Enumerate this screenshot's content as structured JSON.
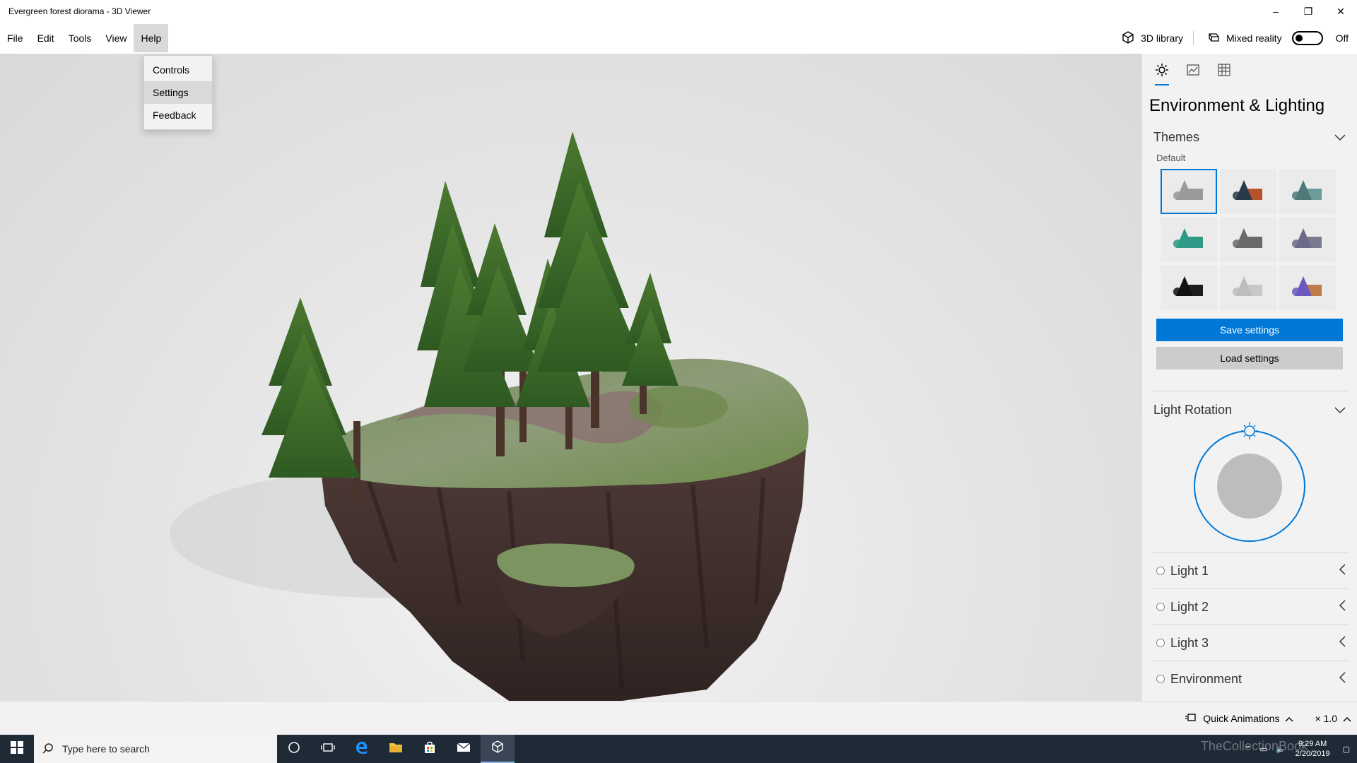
{
  "window": {
    "title": "Evergreen forest diorama - 3D Viewer",
    "minimize": "–",
    "restore": "❐",
    "close": "✕"
  },
  "menu": {
    "items": [
      "File",
      "Edit",
      "Tools",
      "View",
      "Help"
    ],
    "active": "Help"
  },
  "header_right": {
    "library_label": "3D library",
    "library_icon": "cube-icon",
    "mixed_reality_label": "Mixed reality",
    "mixed_reality_icon": "mixed-reality-icon",
    "toggle_state": "Off"
  },
  "help_dropdown": {
    "items": [
      "Controls",
      "Settings",
      "Feedback"
    ],
    "hovered": "Settings"
  },
  "panel": {
    "tabs": [
      "sun-icon",
      "stats-icon",
      "grid-icon"
    ],
    "title": "Environment & Lighting",
    "themes": {
      "heading": "Themes",
      "default_label": "Default",
      "colors": [
        [
          "#9a9a9a",
          "#9a9a9a"
        ],
        [
          "#2b3a4a",
          "#b5522c"
        ],
        [
          "#4f7a7a",
          "#6b9b9b"
        ],
        [
          "#2f9a85",
          "#2f9a85"
        ],
        [
          "#6a6a6a",
          "#6a6a6a"
        ],
        [
          "#6c6c8a",
          "#7a7a90"
        ],
        [
          "#111111",
          "#1c1c1c"
        ],
        [
          "#bdbdbd",
          "#c8c8c8"
        ],
        [
          "#6a5ac0",
          "#c07b4a"
        ]
      ],
      "selected_index": 0
    },
    "save_button": "Save settings",
    "load_button": "Load settings",
    "light_rotation_heading": "Light Rotation",
    "lights": [
      "Light 1",
      "Light 2",
      "Light 3",
      "Environment"
    ],
    "accent": "#0078d7"
  },
  "statusbar": {
    "animations_label": "Quick Animations",
    "zoom": "× 1.0"
  },
  "taskbar": {
    "search_placeholder": "Type here to search",
    "time": "9:29 AM",
    "date": "2/20/2019",
    "watermark": "TheCollectionBook"
  }
}
